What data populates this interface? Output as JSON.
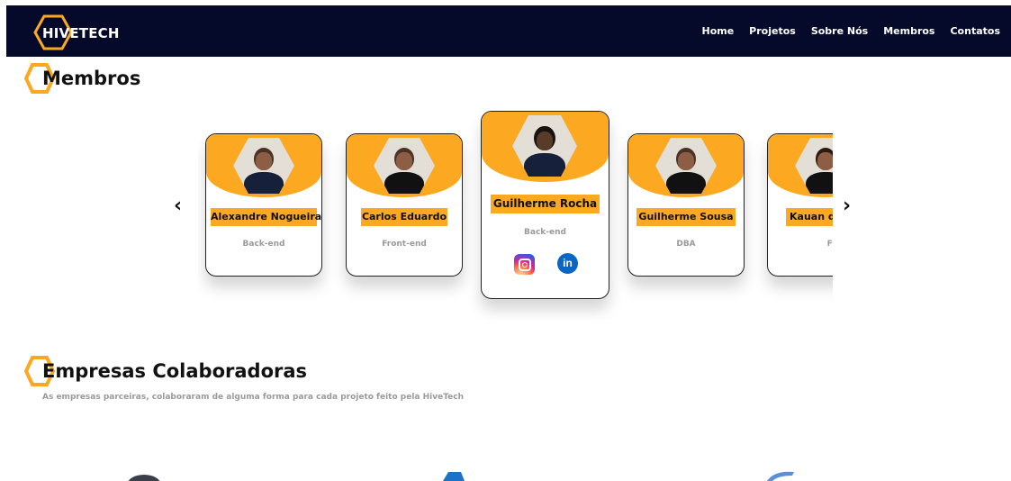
{
  "nav": {
    "logo_text": "HIVETECH",
    "links": [
      "Home",
      "Projetos",
      "Sobre Nós",
      "Membros",
      "Contatos"
    ]
  },
  "members": {
    "title": "Membros",
    "prev_arrow": "‹",
    "next_arrow": "›",
    "cards": [
      {
        "name": "Alexandre Nogueira",
        "role": "Back-end"
      },
      {
        "name": "Carlos Eduardo",
        "role": "Front-end"
      },
      {
        "name": "Guilherme Rocha",
        "role": "Back-end",
        "social": {
          "instagram": "instagram-icon",
          "linkedin": "in"
        }
      },
      {
        "name": "Guilherme Sousa",
        "role": "DBA"
      },
      {
        "name": "Kauan d",
        "role": "Front-e"
      }
    ]
  },
  "empresas": {
    "title": "Empresas Colaboradoras",
    "subtitle": "As empresas parceiras, colaboraram de alguma forma para cada projeto feito pela HiveTech"
  },
  "colors": {
    "nav_bg": "#050a2a",
    "accent": "#fca820",
    "text": "#111111",
    "muted": "#9a9a9a"
  }
}
